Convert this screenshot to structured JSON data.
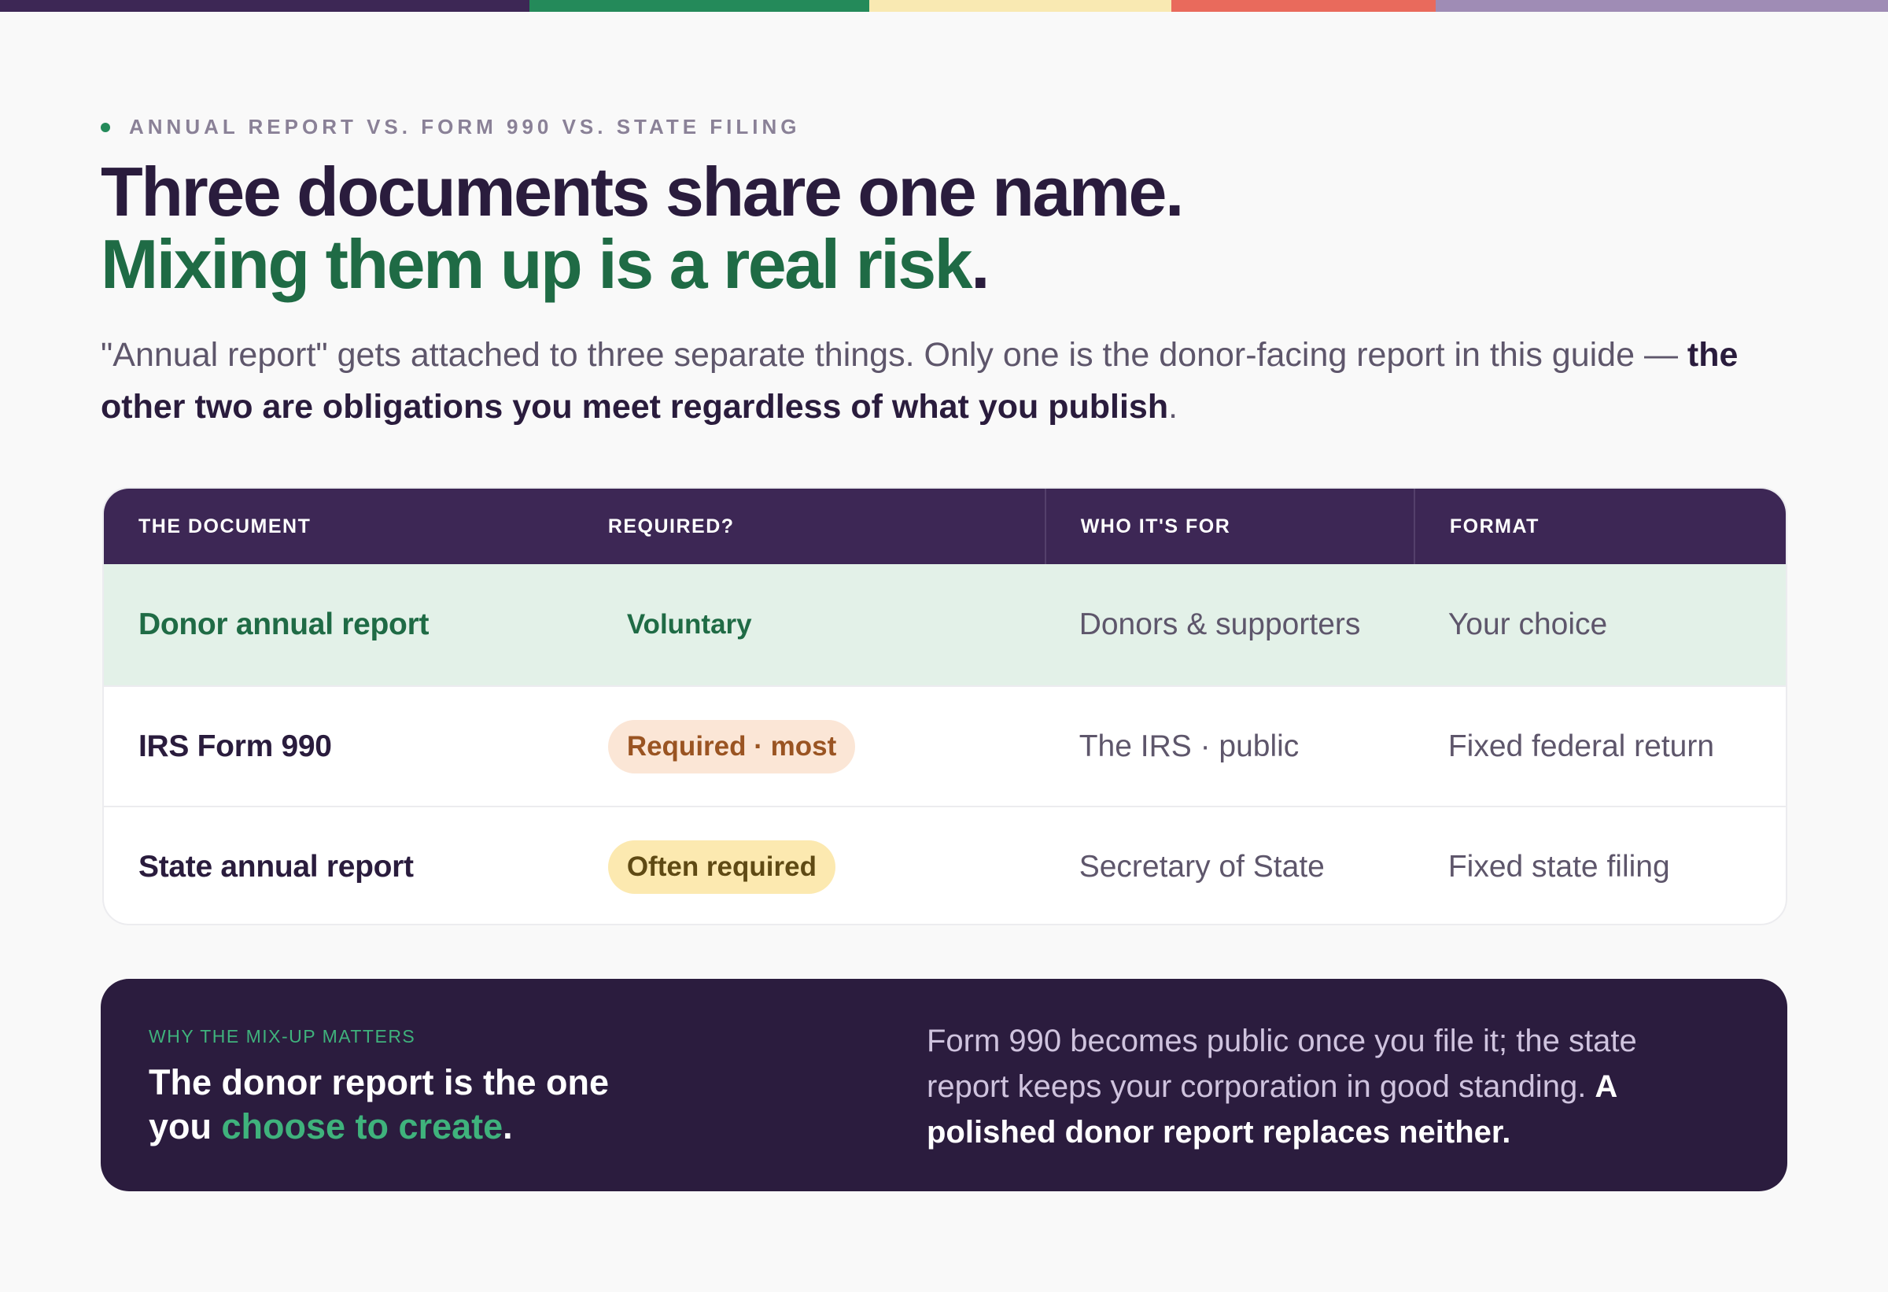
{
  "strip_colors": [
    "#3d2755",
    "#248a5a",
    "#f9e9b2",
    "#e96a5c",
    "#9f8cb5"
  ],
  "eyebrow": {
    "text": "ANNUAL REPORT VS. FORM 990 VS. STATE FILING",
    "dot_color": "#248a5a"
  },
  "headline": {
    "line1": "Three documents share one name.",
    "line2_accent": "Mixing them up is a real risk",
    "line2_end": ".",
    "accent_color": "#1f6b45"
  },
  "lede": {
    "part1": "\"Annual report\" gets attached to three separate things. Only one is the donor-facing report in this guide — ",
    "bold": "the other two are obligations you meet regardless of what you publish",
    "end": "."
  },
  "table": {
    "headers": [
      "THE DOCUMENT",
      "REQUIRED?",
      "WHO IT'S FOR",
      "FORMAT"
    ],
    "rows": [
      {
        "document": "Donor annual report",
        "required": "Voluntary",
        "required_bg": "#e3f1e8",
        "required_color": "#1f6b45",
        "who": "Donors & supporters",
        "format": "Your choice",
        "highlight": true
      },
      {
        "document": "IRS Form 990",
        "required": "Required · most",
        "required_bg": "#fbe6d6",
        "required_color": "#9a5422",
        "who": "The IRS · public",
        "format": "Fixed federal return",
        "highlight": false
      },
      {
        "document": "State annual report",
        "required": "Often required",
        "required_bg": "#fce9b0",
        "required_color": "#5f4a14",
        "who": "Secretary of State",
        "format": "Fixed state filing",
        "highlight": false
      }
    ]
  },
  "callout": {
    "kicker": "WHY THE MIX-UP MATTERS",
    "big_part1": "The donor report is the one you ",
    "big_accent": "choose to create",
    "big_end": ".",
    "side_text": "Form 990 becomes public once you file it; the state report keeps your corporation in good standing. ",
    "side_bold": "A polished donor report replaces neither."
  }
}
